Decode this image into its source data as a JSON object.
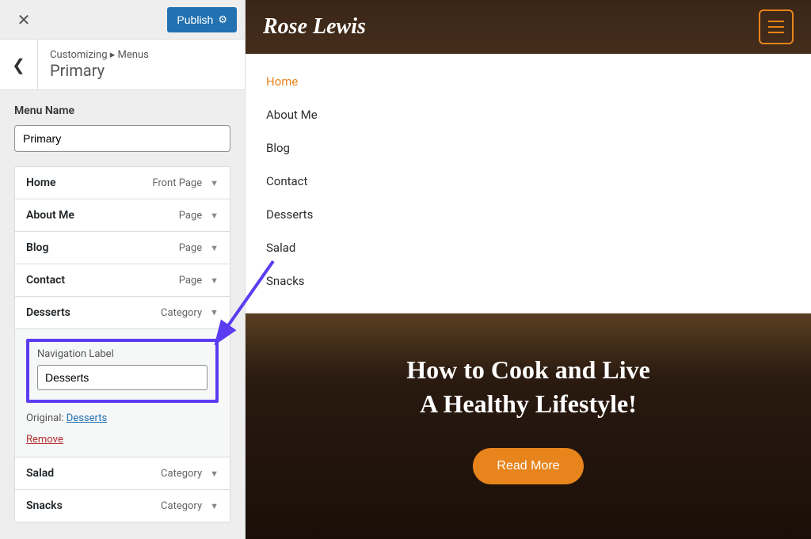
{
  "customizer": {
    "publish_label": "Publish",
    "breadcrumb_prefix": "Customizing ▸ Menus",
    "breadcrumb_title": "Primary",
    "menu_name_label": "Menu Name",
    "menu_name_value": "Primary",
    "items": [
      {
        "title": "Home",
        "type": "Front Page",
        "expanded": false
      },
      {
        "title": "About Me",
        "type": "Page",
        "expanded": false
      },
      {
        "title": "Blog",
        "type": "Page",
        "expanded": false
      },
      {
        "title": "Contact",
        "type": "Page",
        "expanded": false
      },
      {
        "title": "Desserts",
        "type": "Category",
        "expanded": true
      },
      {
        "title": "Salad",
        "type": "Category",
        "expanded": false
      },
      {
        "title": "Snacks",
        "type": "Category",
        "expanded": false
      }
    ],
    "expanded_item": {
      "nav_label_text": "Navigation Label",
      "nav_label_value": "Desserts",
      "original_label": "Original:",
      "original_link": "Desserts",
      "remove_label": "Remove"
    }
  },
  "preview": {
    "site_title": "Rose Lewis",
    "nav_items": [
      "Home",
      "About Me",
      "Blog",
      "Contact",
      "Desserts",
      "Salad",
      "Snacks"
    ],
    "active_nav_index": 0,
    "hero_line1": "How to Cook and Live",
    "hero_line2": "A Healthy Lifestyle!",
    "read_more_label": "Read More"
  }
}
